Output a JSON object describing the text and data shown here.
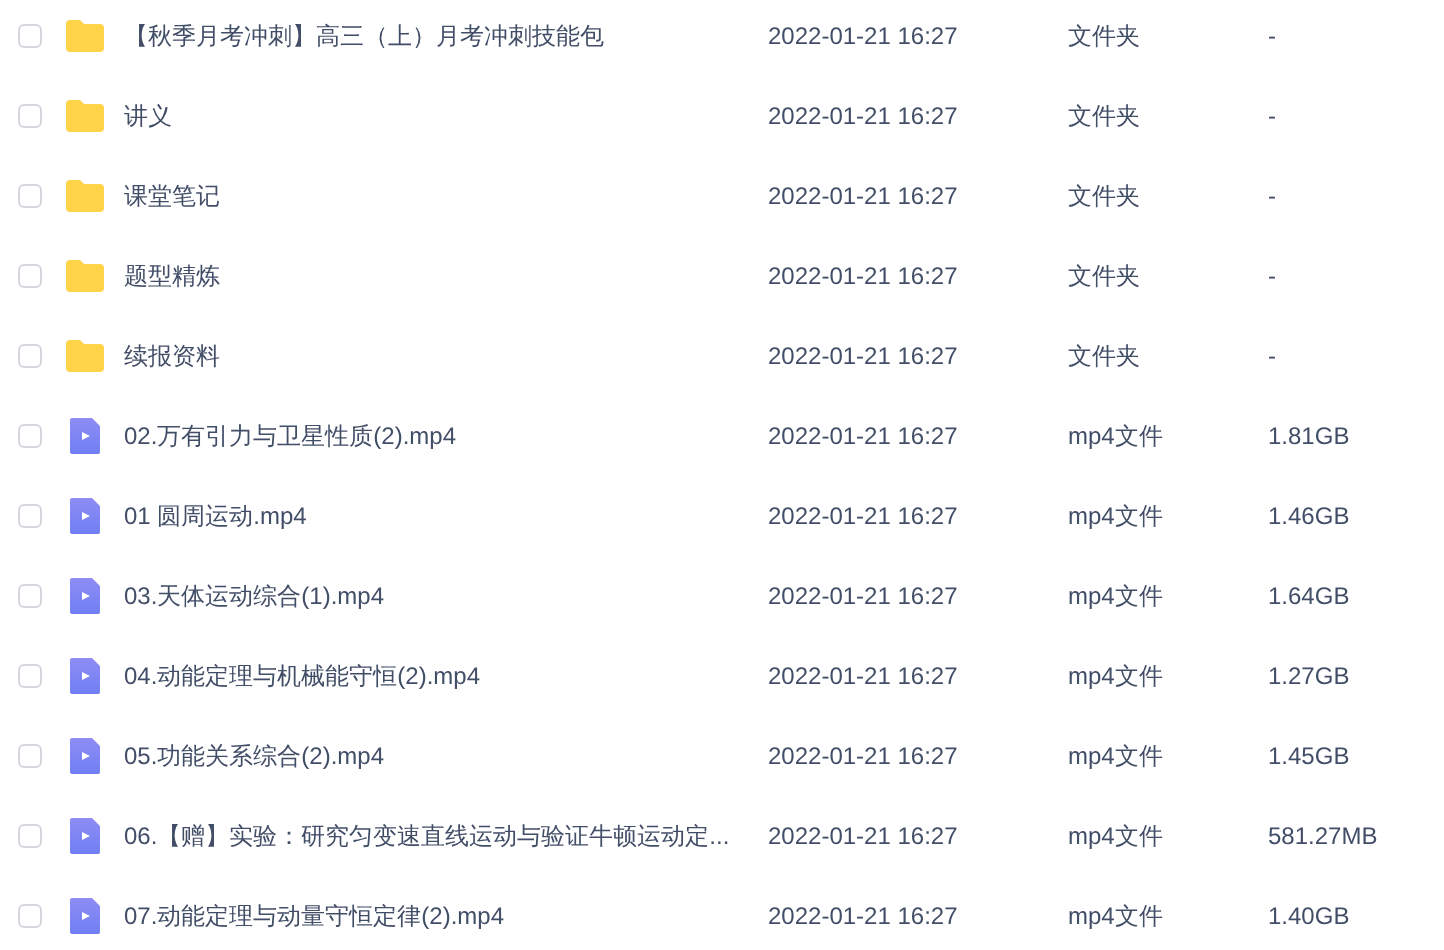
{
  "files": [
    {
      "kind": "folder",
      "checked": false,
      "name": "【秋季月考冲刺】高三（上）月考冲刺技能包",
      "modified": "2022-01-21 16:27",
      "type": "文件夹",
      "size": "-"
    },
    {
      "kind": "folder",
      "checked": false,
      "name": "讲义",
      "modified": "2022-01-21 16:27",
      "type": "文件夹",
      "size": "-"
    },
    {
      "kind": "folder",
      "checked": false,
      "name": "课堂笔记",
      "modified": "2022-01-21 16:27",
      "type": "文件夹",
      "size": "-"
    },
    {
      "kind": "folder",
      "checked": false,
      "name": "题型精炼",
      "modified": "2022-01-21 16:27",
      "type": "文件夹",
      "size": "-"
    },
    {
      "kind": "folder",
      "checked": false,
      "name": "续报资料",
      "modified": "2022-01-21 16:27",
      "type": "文件夹",
      "size": "-"
    },
    {
      "kind": "video",
      "checked": false,
      "name": "02.万有引力与卫星性质(2).mp4",
      "modified": "2022-01-21 16:27",
      "type": "mp4文件",
      "size": "1.81GB"
    },
    {
      "kind": "video",
      "checked": false,
      "name": "01 圆周运动.mp4",
      "modified": "2022-01-21 16:27",
      "type": "mp4文件",
      "size": "1.46GB"
    },
    {
      "kind": "video",
      "checked": false,
      "name": "03.天体运动综合(1).mp4",
      "modified": "2022-01-21 16:27",
      "type": "mp4文件",
      "size": "1.64GB"
    },
    {
      "kind": "video",
      "checked": false,
      "name": "04.动能定理与机械能守恒(2).mp4",
      "modified": "2022-01-21 16:27",
      "type": "mp4文件",
      "size": "1.27GB"
    },
    {
      "kind": "video",
      "checked": false,
      "name": "05.功能关系综合(2).mp4",
      "modified": "2022-01-21 16:27",
      "type": "mp4文件",
      "size": "1.45GB"
    },
    {
      "kind": "video",
      "checked": false,
      "name": "06.【赠】实验：研究匀变速直线运动与验证牛顿运动定...",
      "modified": "2022-01-21 16:27",
      "type": "mp4文件",
      "size": "581.27MB"
    },
    {
      "kind": "video",
      "checked": false,
      "name": "07.动能定理与动量守恒定律(2).mp4",
      "modified": "2022-01-21 16:27",
      "type": "mp4文件",
      "size": "1.40GB"
    }
  ]
}
